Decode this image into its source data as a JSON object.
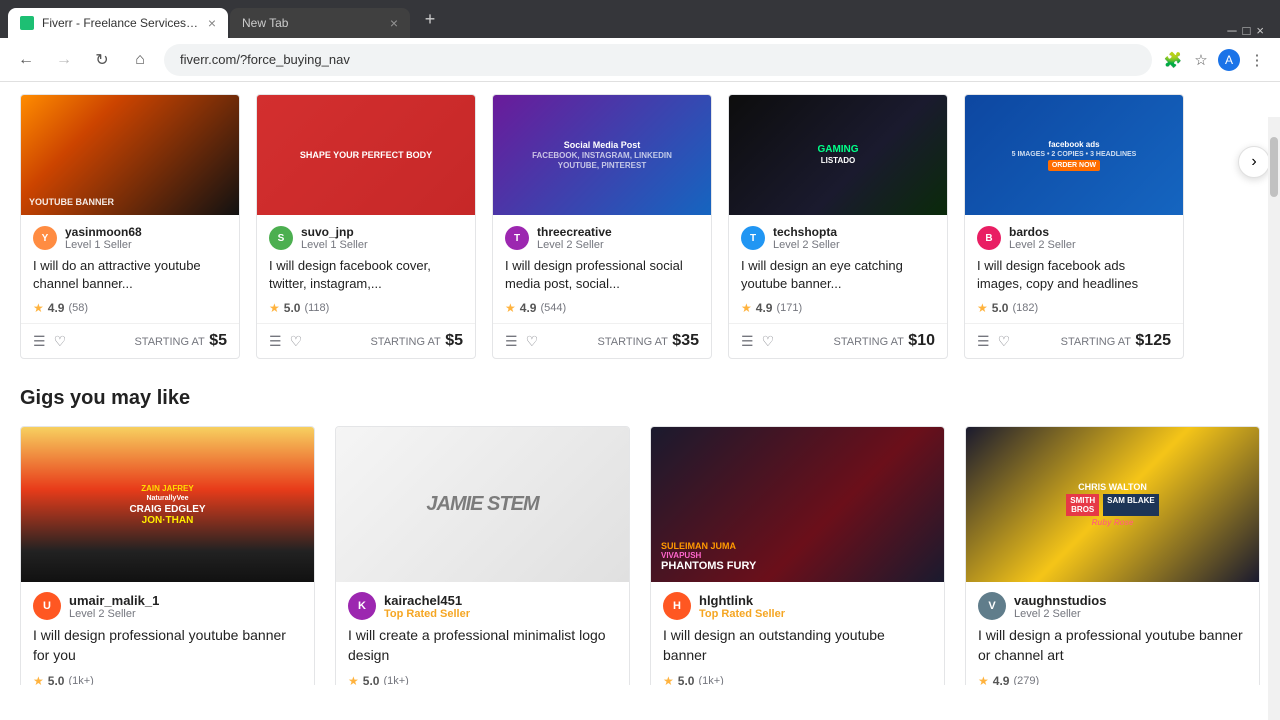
{
  "browser": {
    "tabs": [
      {
        "id": "tab1",
        "title": "Fiverr - Freelance Services Mark...",
        "active": true,
        "favicon": "F",
        "url": "fiverr.com/?force_buying_nav"
      },
      {
        "id": "tab2",
        "title": "New Tab",
        "active": false,
        "favicon": "",
        "url": ""
      }
    ],
    "address": "fiverr.com/?force_buying_nav",
    "back_disabled": false,
    "forward_disabled": false
  },
  "top_gigs": [
    {
      "id": "g1",
      "image_style": "img-youtube",
      "seller_name": "yasinmoon68",
      "seller_level": "Level 1 Seller",
      "title": "I will do an attractive youtube channel banner...",
      "rating": "4.9",
      "reviews": "58",
      "price": "$5",
      "starting_at": "STARTING AT"
    },
    {
      "id": "g2",
      "image_style": "img-social",
      "seller_name": "suvo_jnp",
      "seller_level": "Level 1 Seller",
      "title": "I will design facebook cover, twitter, instagram,...",
      "rating": "5.0",
      "reviews": "118",
      "price": "$5",
      "starting_at": "STARTING AT"
    },
    {
      "id": "g3",
      "image_style": "img-social",
      "seller_name": "threecreative",
      "seller_level": "Level 2 Seller",
      "title": "I will design professional social media post, social...",
      "rating": "4.9",
      "reviews": "544",
      "price": "$35",
      "starting_at": "STARTING AT"
    },
    {
      "id": "g4",
      "image_style": "img-gaming",
      "seller_name": "techshopta",
      "seller_level": "Level 2 Seller",
      "title": "I will design an eye catching youtube banner...",
      "rating": "4.9",
      "reviews": "171",
      "price": "$10",
      "starting_at": "STARTING AT"
    },
    {
      "id": "g5",
      "image_style": "img-fbads",
      "seller_name": "bardos",
      "seller_level": "Level 2 Seller",
      "title": "I will design facebook ads images, copy and headlines",
      "rating": "5.0",
      "reviews": "182",
      "price": "$125",
      "starting_at": "STARTING AT"
    }
  ],
  "section_title": "Gigs you may like",
  "bottom_gigs": [
    {
      "id": "bg1",
      "image_style": "img-youtube2",
      "seller_name": "umair_malik_1",
      "seller_level": "Level 2 Seller",
      "seller_level_type": "normal",
      "title": "I will design professional youtube banner for you",
      "rating": "5.0",
      "reviews": "1k+"
    },
    {
      "id": "bg2",
      "image_style": "img-logo",
      "seller_name": "kairachel451",
      "seller_level": "Top Rated Seller",
      "seller_level_type": "top",
      "title": "I will create a professional minimalist logo design",
      "rating": "5.0",
      "reviews": "1k+"
    },
    {
      "id": "bg3",
      "image_style": "img-banner2",
      "seller_name": "hlghtlink",
      "seller_level": "Top Rated Seller",
      "seller_level_type": "top",
      "title": "I will design an outstanding youtube banner",
      "rating": "5.0",
      "reviews": "1k+"
    },
    {
      "id": "bg4",
      "image_style": "img-youtube3",
      "seller_name": "vaughnstudios",
      "seller_level": "Level 2 Seller",
      "seller_level_type": "normal",
      "title": "I will design a professional youtube banner or channel art",
      "rating": "4.9",
      "reviews": "279"
    }
  ]
}
